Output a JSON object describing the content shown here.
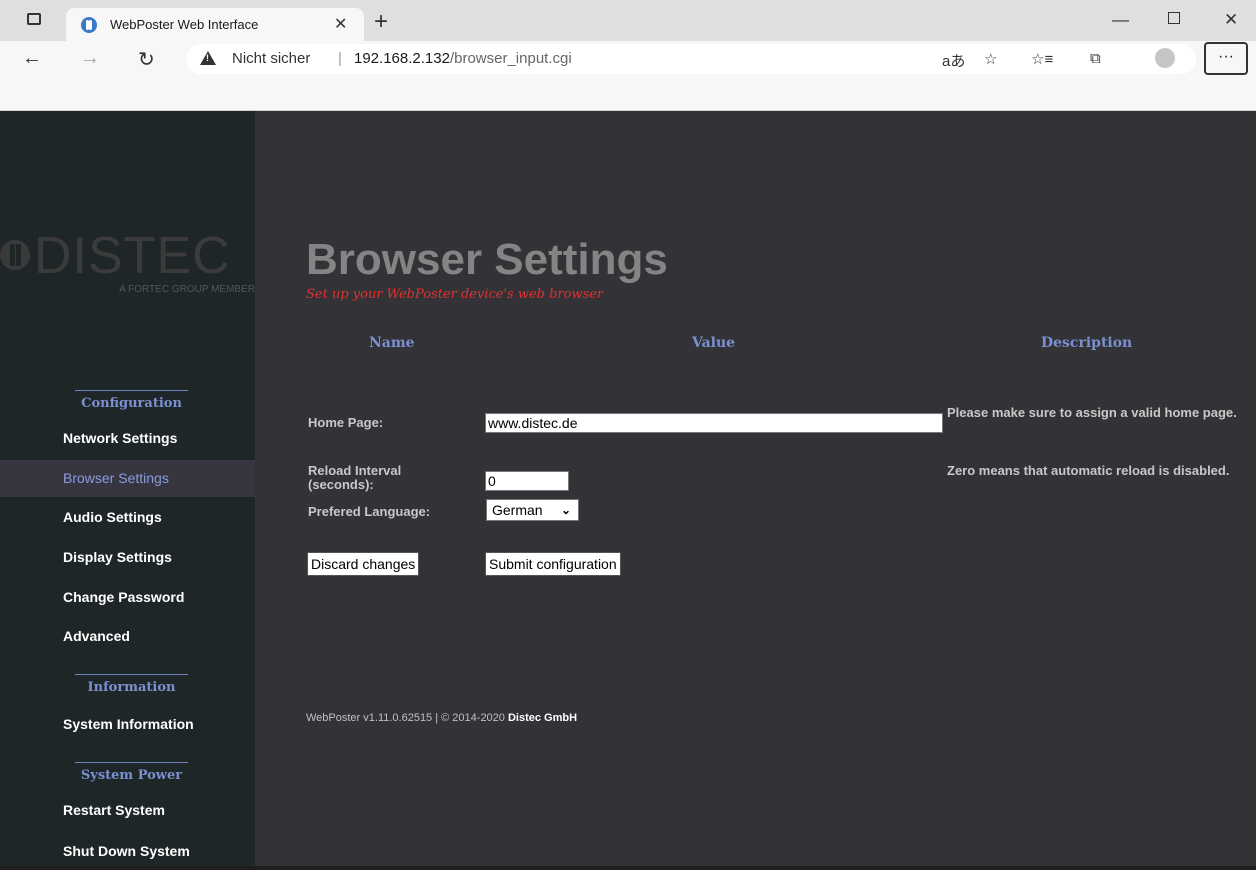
{
  "browser": {
    "tab_title": "WebPoster Web Interface",
    "security_label": "Nicht sicher",
    "url_host": "192.168.2.132",
    "url_path": "/browser_input.cgi"
  },
  "logo": {
    "word": "DISTEC",
    "tagline": "A FORTEC GROUP MEMBER"
  },
  "sidebar": {
    "sections": [
      {
        "title": "Configuration"
      },
      {
        "title": "Information"
      },
      {
        "title": "System Power"
      }
    ],
    "items": [
      {
        "label": "Network Settings"
      },
      {
        "label": "Browser Settings",
        "active": true
      },
      {
        "label": "Audio Settings"
      },
      {
        "label": "Display Settings"
      },
      {
        "label": "Change Password"
      },
      {
        "label": "Advanced"
      },
      {
        "label": "System Information"
      },
      {
        "label": "Restart System"
      },
      {
        "label": "Shut Down System"
      }
    ]
  },
  "page": {
    "title": "Browser Settings",
    "subtitle": "Set up your WebPoster device's web browser",
    "columns": {
      "name": "Name",
      "value": "Value",
      "description": "Description"
    }
  },
  "form": {
    "home_page": {
      "label": "Home Page:",
      "value": "www.distec.de",
      "description": "Please make sure to assign a valid home page."
    },
    "reload_interval": {
      "label_line1": "Reload Interval",
      "label_line2": "(seconds):",
      "value": "0",
      "description": "Zero means that automatic reload is disabled."
    },
    "language": {
      "label": "Prefered Language:",
      "selected": "German"
    },
    "discard_label": "Discard changes",
    "submit_label": "Submit configuration"
  },
  "footer": {
    "version": "WebPoster v1.11.0.62515 | © 2014-2020 ",
    "company": "Distec GmbH"
  },
  "colors": {
    "accent": "#7a90d0",
    "subtitle": "#e03030",
    "sidebar_bg": "#1f2628",
    "content_bg": "#333337"
  }
}
